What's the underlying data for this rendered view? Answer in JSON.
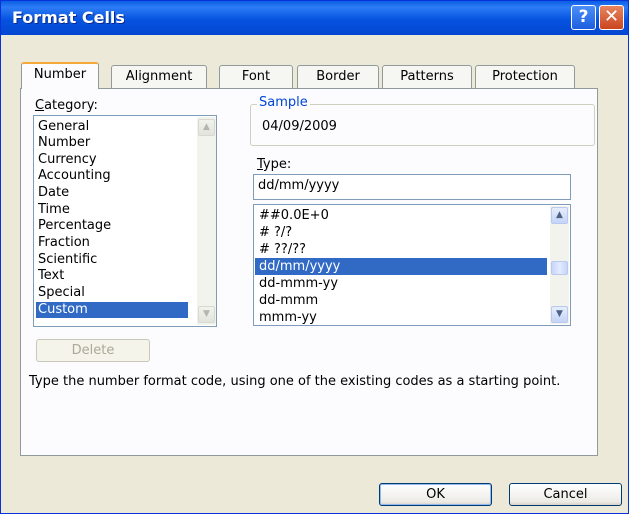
{
  "window": {
    "title": "Format Cells"
  },
  "titlebar": {
    "help_glyph": "?",
    "close_glyph": "✕"
  },
  "tabs": [
    {
      "label": "Number",
      "active": true
    },
    {
      "label": "Alignment",
      "active": false
    },
    {
      "label": "Font",
      "active": false
    },
    {
      "label": "Border",
      "active": false
    },
    {
      "label": "Patterns",
      "active": false
    },
    {
      "label": "Protection",
      "active": false
    }
  ],
  "category": {
    "label_underlined": "C",
    "label_rest": "ategory:",
    "items": [
      "General",
      "Number",
      "Currency",
      "Accounting",
      "Date",
      "Time",
      "Percentage",
      "Fraction",
      "Scientific",
      "Text",
      "Special",
      "Custom"
    ],
    "selected": "Custom"
  },
  "sample": {
    "legend": "Sample",
    "value": "04/09/2009"
  },
  "type": {
    "label_underlined": "T",
    "label_rest": "ype:",
    "value": "dd/mm/yyyy",
    "items": [
      "##0.0E+0",
      "# ?/?",
      "# ??/??",
      "dd/mm/yyyy",
      "dd-mmm-yy",
      "dd-mmm",
      "mmm-yy"
    ],
    "selected": "dd/mm/yyyy"
  },
  "buttons": {
    "delete": "Delete",
    "ok": "OK",
    "cancel": "Cancel"
  },
  "description": "Type the number format code, using one of the existing codes as a starting point.",
  "colors": {
    "titlebar": "#0553e0",
    "selection": "#316ac5",
    "dialog_bg": "#ece9d8",
    "active_tab_accent": "#f4a93a"
  }
}
